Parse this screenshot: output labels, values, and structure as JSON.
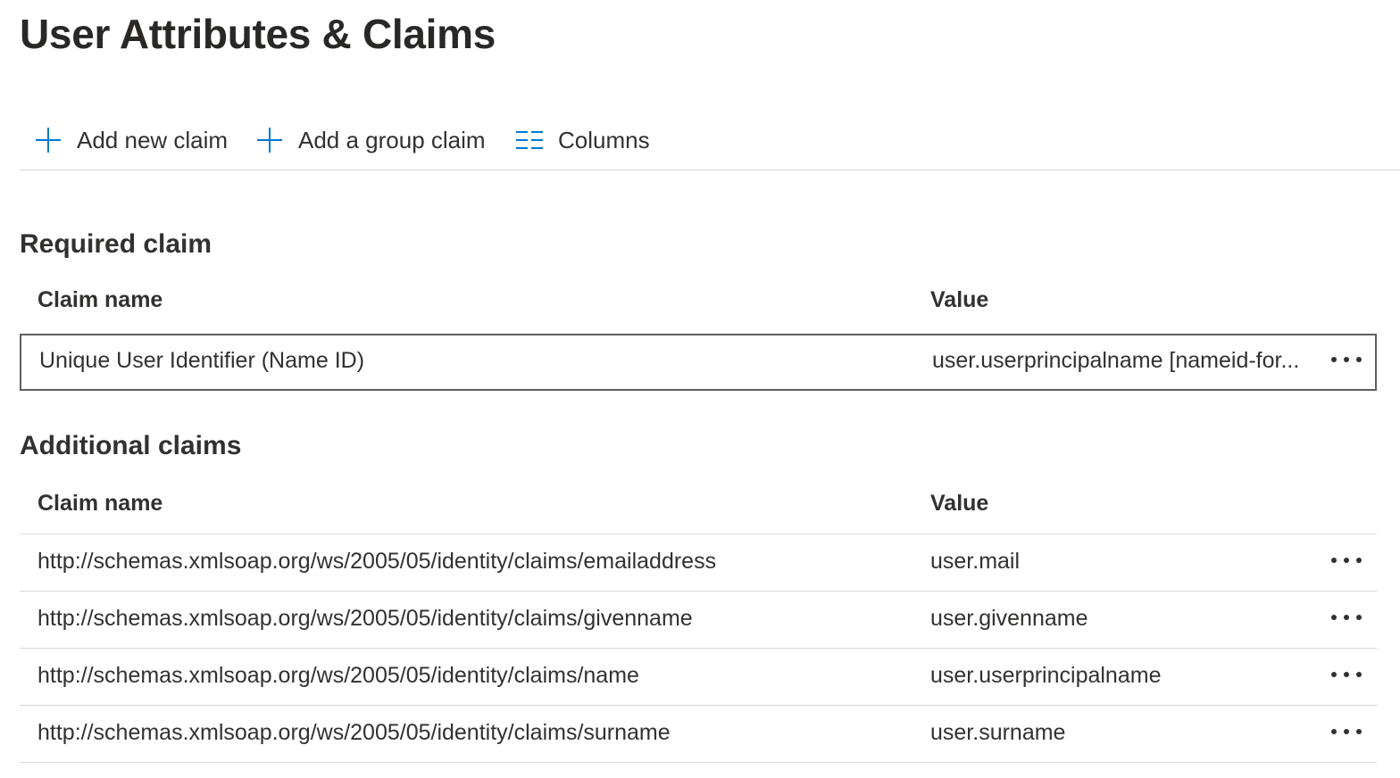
{
  "page": {
    "title": "User Attributes & Claims"
  },
  "toolbar": {
    "add_claim_label": "Add new claim",
    "add_group_claim_label": "Add a group claim",
    "columns_label": "Columns"
  },
  "required": {
    "title": "Required claim",
    "columns": {
      "name": "Claim name",
      "value": "Value"
    },
    "rows": [
      {
        "name": "Unique User Identifier (Name ID)",
        "value": "user.userprincipalname [nameid-for..."
      }
    ]
  },
  "additional": {
    "title": "Additional claims",
    "columns": {
      "name": "Claim name",
      "value": "Value"
    },
    "rows": [
      {
        "name": "http://schemas.xmlsoap.org/ws/2005/05/identity/claims/emailaddress",
        "value": "user.mail"
      },
      {
        "name": "http://schemas.xmlsoap.org/ws/2005/05/identity/claims/givenname",
        "value": "user.givenname"
      },
      {
        "name": "http://schemas.xmlsoap.org/ws/2005/05/identity/claims/name",
        "value": "user.userprincipalname"
      },
      {
        "name": "http://schemas.xmlsoap.org/ws/2005/05/identity/claims/surname",
        "value": "user.surname"
      }
    ]
  },
  "colors": {
    "accent": "#0078d4",
    "text": "#323130",
    "divider": "#d6d6d6"
  },
  "icons": {
    "add": "plus-icon",
    "columns": "columns-icon",
    "more": "more-options-icon"
  }
}
